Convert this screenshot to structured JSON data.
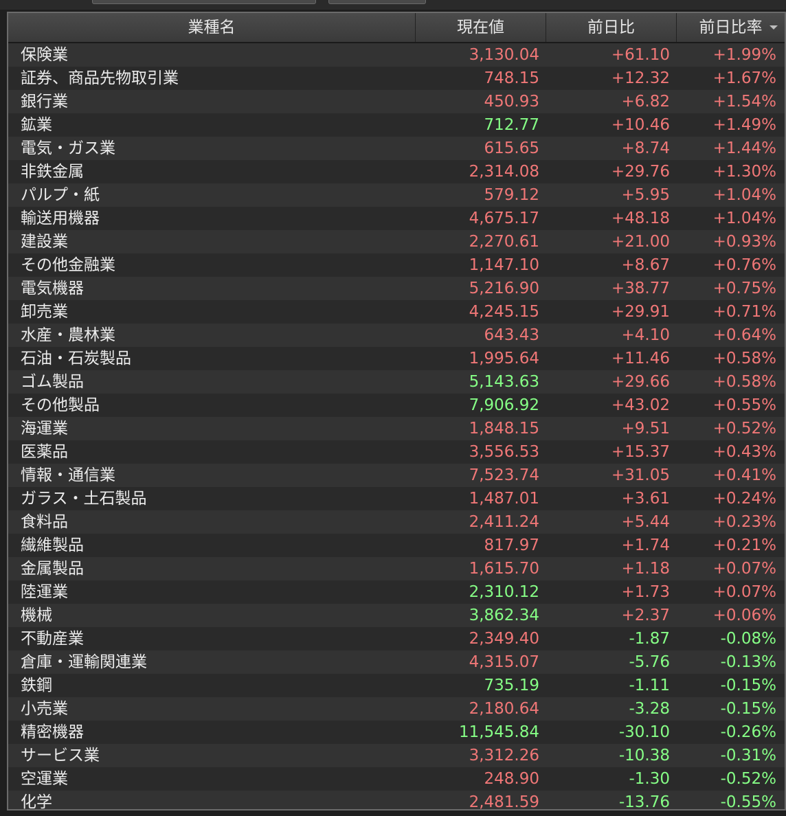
{
  "colors": {
    "up": "#f07777",
    "down": "#86ff86",
    "background": "#2e2e2e",
    "header": "#444444"
  },
  "table": {
    "headers": {
      "name": "業種名",
      "price": "現在値",
      "change": "前日比",
      "change_rate": "前日比率"
    },
    "sort_icon": "sort-descending-icon",
    "rows": [
      {
        "name": "保険業",
        "price": "3,130.04",
        "price_dir": "up",
        "change": "+61.10",
        "change_rate": "+1.99%"
      },
      {
        "name": "証券、商品先物取引業",
        "price": "748.15",
        "price_dir": "up",
        "change": "+12.32",
        "change_rate": "+1.67%"
      },
      {
        "name": "銀行業",
        "price": "450.93",
        "price_dir": "up",
        "change": "+6.82",
        "change_rate": "+1.54%"
      },
      {
        "name": "鉱業",
        "price": "712.77",
        "price_dir": "down",
        "change": "+10.46",
        "change_rate": "+1.49%"
      },
      {
        "name": "電気・ガス業",
        "price": "615.65",
        "price_dir": "up",
        "change": "+8.74",
        "change_rate": "+1.44%"
      },
      {
        "name": "非鉄金属",
        "price": "2,314.08",
        "price_dir": "up",
        "change": "+29.76",
        "change_rate": "+1.30%"
      },
      {
        "name": "パルプ・紙",
        "price": "579.12",
        "price_dir": "up",
        "change": "+5.95",
        "change_rate": "+1.04%"
      },
      {
        "name": "輸送用機器",
        "price": "4,675.17",
        "price_dir": "up",
        "change": "+48.18",
        "change_rate": "+1.04%"
      },
      {
        "name": "建設業",
        "price": "2,270.61",
        "price_dir": "up",
        "change": "+21.00",
        "change_rate": "+0.93%"
      },
      {
        "name": "その他金融業",
        "price": "1,147.10",
        "price_dir": "up",
        "change": "+8.67",
        "change_rate": "+0.76%"
      },
      {
        "name": "電気機器",
        "price": "5,216.90",
        "price_dir": "up",
        "change": "+38.77",
        "change_rate": "+0.75%"
      },
      {
        "name": "卸売業",
        "price": "4,245.15",
        "price_dir": "up",
        "change": "+29.91",
        "change_rate": "+0.71%"
      },
      {
        "name": "水産・農林業",
        "price": "643.43",
        "price_dir": "up",
        "change": "+4.10",
        "change_rate": "+0.64%"
      },
      {
        "name": "石油・石炭製品",
        "price": "1,995.64",
        "price_dir": "up",
        "change": "+11.46",
        "change_rate": "+0.58%"
      },
      {
        "name": "ゴム製品",
        "price": "5,143.63",
        "price_dir": "down",
        "change": "+29.66",
        "change_rate": "+0.58%"
      },
      {
        "name": "その他製品",
        "price": "7,906.92",
        "price_dir": "down",
        "change": "+43.02",
        "change_rate": "+0.55%"
      },
      {
        "name": "海運業",
        "price": "1,848.15",
        "price_dir": "up",
        "change": "+9.51",
        "change_rate": "+0.52%"
      },
      {
        "name": "医薬品",
        "price": "3,556.53",
        "price_dir": "up",
        "change": "+15.37",
        "change_rate": "+0.43%"
      },
      {
        "name": "情報・通信業",
        "price": "7,523.74",
        "price_dir": "up",
        "change": "+31.05",
        "change_rate": "+0.41%"
      },
      {
        "name": "ガラス・土石製品",
        "price": "1,487.01",
        "price_dir": "up",
        "change": "+3.61",
        "change_rate": "+0.24%"
      },
      {
        "name": "食料品",
        "price": "2,411.24",
        "price_dir": "up",
        "change": "+5.44",
        "change_rate": "+0.23%"
      },
      {
        "name": "繊維製品",
        "price": "817.97",
        "price_dir": "up",
        "change": "+1.74",
        "change_rate": "+0.21%"
      },
      {
        "name": "金属製品",
        "price": "1,615.70",
        "price_dir": "up",
        "change": "+1.18",
        "change_rate": "+0.07%"
      },
      {
        "name": "陸運業",
        "price": "2,310.12",
        "price_dir": "down",
        "change": "+1.73",
        "change_rate": "+0.07%"
      },
      {
        "name": "機械",
        "price": "3,862.34",
        "price_dir": "down",
        "change": "+2.37",
        "change_rate": "+0.06%"
      },
      {
        "name": "不動産業",
        "price": "2,349.40",
        "price_dir": "up",
        "change": "-1.87",
        "change_rate": "-0.08%"
      },
      {
        "name": "倉庫・運輸関連業",
        "price": "4,315.07",
        "price_dir": "up",
        "change": "-5.76",
        "change_rate": "-0.13%"
      },
      {
        "name": "鉄鋼",
        "price": "735.19",
        "price_dir": "down",
        "change": "-1.11",
        "change_rate": "-0.15%"
      },
      {
        "name": "小売業",
        "price": "2,180.64",
        "price_dir": "up",
        "change": "-3.28",
        "change_rate": "-0.15%"
      },
      {
        "name": "精密機器",
        "price": "11,545.84",
        "price_dir": "down",
        "change": "-30.10",
        "change_rate": "-0.26%"
      },
      {
        "name": "サービス業",
        "price": "3,312.26",
        "price_dir": "up",
        "change": "-10.38",
        "change_rate": "-0.31%"
      },
      {
        "name": "空運業",
        "price": "248.90",
        "price_dir": "up",
        "change": "-1.30",
        "change_rate": "-0.52%"
      },
      {
        "name": "化学",
        "price": "2,481.59",
        "price_dir": "up",
        "change": "-13.76",
        "change_rate": "-0.55%"
      }
    ]
  }
}
